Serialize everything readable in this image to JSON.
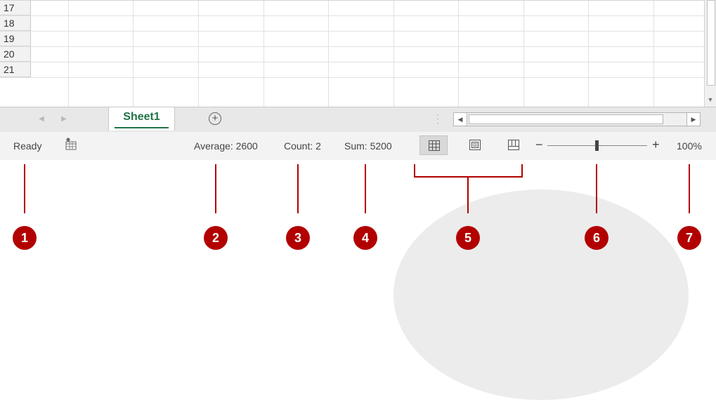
{
  "grid": {
    "row_numbers": [
      "17",
      "18",
      "19",
      "20",
      "21"
    ]
  },
  "tabbar": {
    "sheet_tab_label": "Sheet1",
    "add_sheet_icon": "+"
  },
  "statusbar": {
    "mode": "Ready",
    "average": "Average: 2600",
    "count": "Count: 2",
    "sum": "Sum: 5200",
    "zoom_percent": "100%",
    "zoom_level": 100,
    "active_view": "normal"
  },
  "callouts": {
    "numbers": [
      "1",
      "2",
      "3",
      "4",
      "5",
      "6",
      "7"
    ],
    "color": "#b20000"
  },
  "colors": {
    "excel_green": "#217346",
    "statusbar_bg": "#f3f3f3"
  },
  "icons": {
    "nav_left": "triangle-left-icon",
    "nav_right": "triangle-right-icon",
    "add_sheet": "plus-circle-icon",
    "macro": "macro-recording-icon",
    "normal_view": "normal-view-icon",
    "page_layout": "page-layout-view-icon",
    "page_break": "page-break-preview-icon"
  }
}
